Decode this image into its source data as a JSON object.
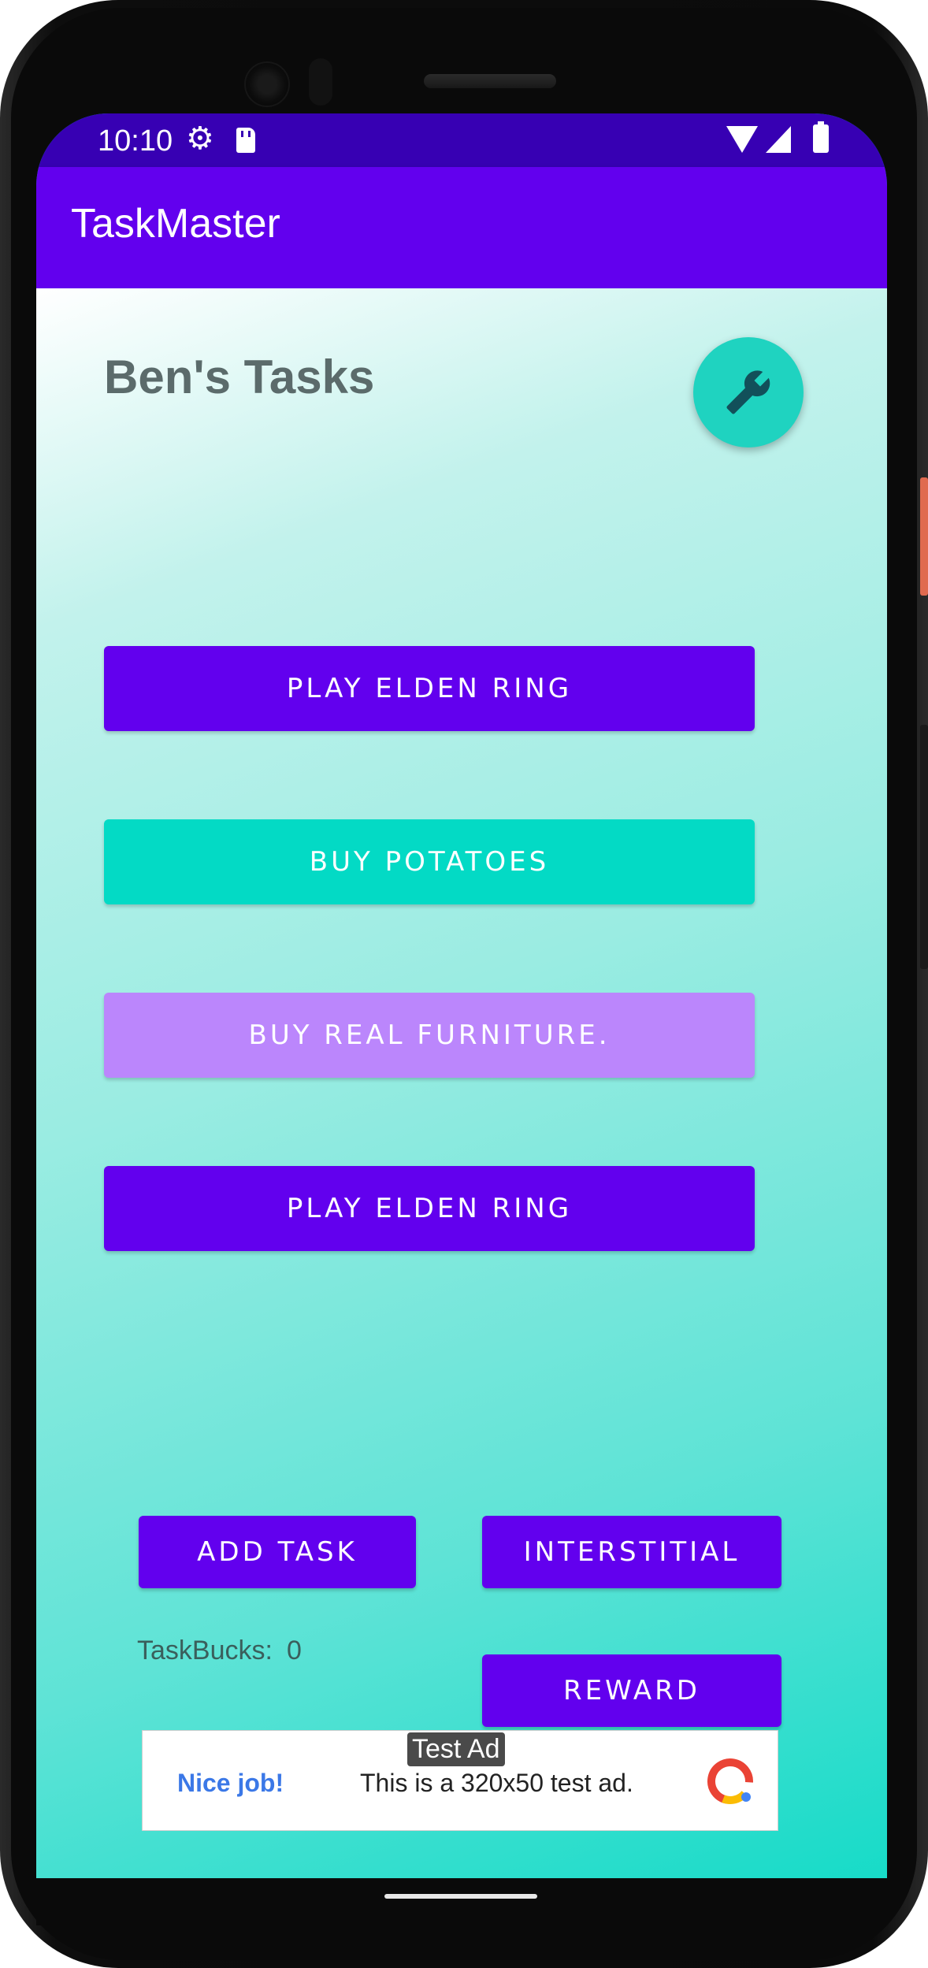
{
  "status_bar": {
    "time": "10:10",
    "icons": [
      "settings-icon",
      "sd-card-icon",
      "wifi-icon",
      "signal-icon",
      "battery-icon"
    ]
  },
  "app_bar": {
    "title": "TaskMaster"
  },
  "main": {
    "heading": "Ben's Tasks",
    "fab_icon": "wrench-icon",
    "tasks": [
      {
        "label": "PLAY ELDEN RING",
        "color": "#6200ee"
      },
      {
        "label": "BUY POTATOES",
        "color": "#03dac5"
      },
      {
        "label": "BUY REAL FURNITURE.",
        "color": "#bb86fc"
      },
      {
        "label": "PLAY ELDEN RING",
        "color": "#6200ee"
      }
    ],
    "actions": {
      "add_task": "ADD TASK",
      "interstitial": "INTERSTITIAL",
      "reward": "REWARD"
    },
    "taskbucks_label": "TaskBucks:",
    "taskbucks_value": "0"
  },
  "ad": {
    "badge": "Test Ad",
    "headline": "Nice job!",
    "text": "This is a 320x50 test ad."
  },
  "colors": {
    "primary": "#6200ee",
    "primary_dark": "#3700b3",
    "secondary": "#03dac5"
  }
}
